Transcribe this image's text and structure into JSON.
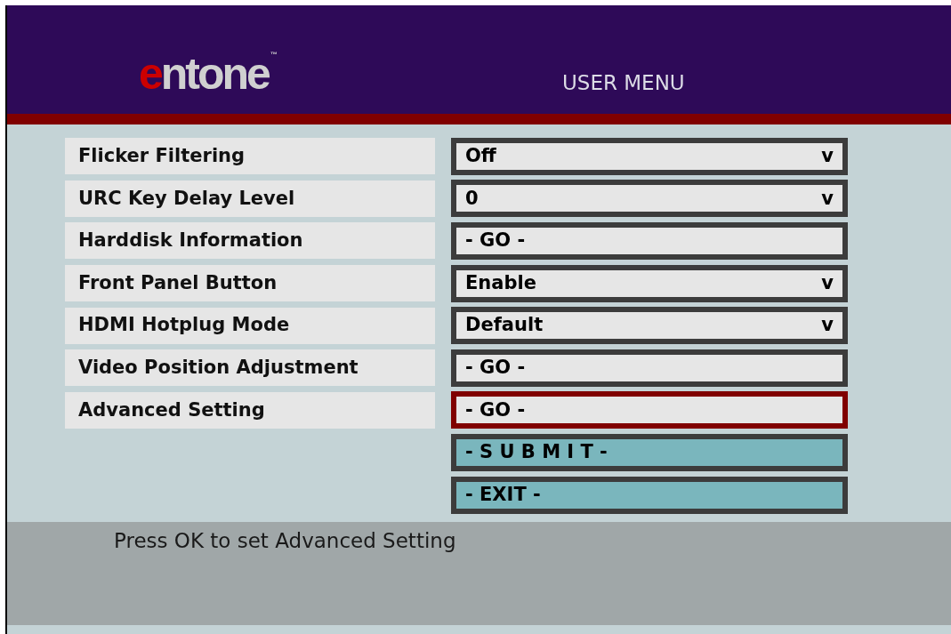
{
  "header": {
    "logo": {
      "accent": "e",
      "rest": "ntone",
      "mark": "™"
    },
    "title": "USER MENU"
  },
  "settings": [
    {
      "label": "Flicker Filtering",
      "control": {
        "kind": "dropdown",
        "value": "Off",
        "arrow": "v",
        "selected": false
      }
    },
    {
      "label": "URC Key Delay Level",
      "control": {
        "kind": "dropdown",
        "value": "0",
        "arrow": "v",
        "selected": false
      }
    },
    {
      "label": "Harddisk Information",
      "control": {
        "kind": "go",
        "value": "- GO -",
        "selected": false
      }
    },
    {
      "label": "Front Panel Button",
      "control": {
        "kind": "dropdown",
        "value": "Enable",
        "arrow": "v",
        "selected": false
      }
    },
    {
      "label": "HDMI Hotplug Mode",
      "control": {
        "kind": "dropdown",
        "value": "Default",
        "arrow": "v",
        "selected": false
      }
    },
    {
      "label": "Video Position Adjustment",
      "control": {
        "kind": "go",
        "value": "- GO -",
        "selected": false
      }
    },
    {
      "label": "Advanced Setting",
      "control": {
        "kind": "go",
        "value": "- GO -",
        "selected": true
      }
    }
  ],
  "buttons": [
    {
      "label": "- S U B M I T -",
      "selected": false
    },
    {
      "label": "- EXIT -",
      "selected": false
    }
  ],
  "hint": "Press OK to set Advanced Setting"
}
